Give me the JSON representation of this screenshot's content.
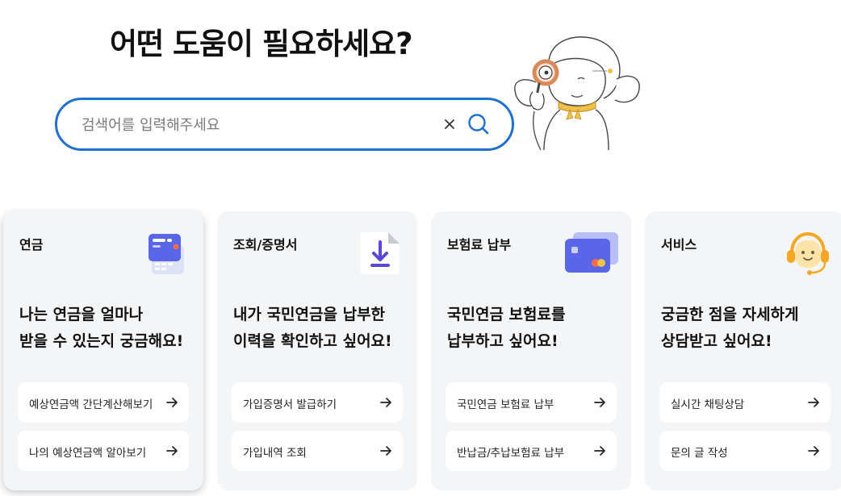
{
  "headline": "어떤 도움이 필요하세요?",
  "search": {
    "placeholder": "검색어를 입력해주세요",
    "value": ""
  },
  "accent_color": "#1f6fd1",
  "cards": [
    {
      "title": "연금",
      "icon": "pension-calculator-icon",
      "desc_line1": "나는 연금을 얼마나",
      "desc_line2": "받을 수 있는지 궁금해요!",
      "links": [
        "예상연금액 간단계산해보기",
        "나의 예상연금액 알아보기"
      ]
    },
    {
      "title": "조회/증명서",
      "icon": "document-download-icon",
      "desc_line1": "내가 국민연금을 납부한",
      "desc_line2": "이력을 확인하고 싶어요!",
      "links": [
        "가입증명서 발급하기",
        "가입내역 조회"
      ]
    },
    {
      "title": "보험료 납부",
      "icon": "credit-card-icon",
      "desc_line1": "국민연금 보험료를",
      "desc_line2": "납부하고 싶어요!",
      "links": [
        "국민연금 보험료 납부",
        "반납금/추납보험료 납부"
      ]
    },
    {
      "title": "서비스",
      "icon": "headset-chat-icon",
      "desc_line1": "궁금한 점을 자세하게",
      "desc_line2": "상담받고 싶어요!",
      "links": [
        "실시간 채팅상담",
        "문의 글 작성"
      ]
    }
  ]
}
